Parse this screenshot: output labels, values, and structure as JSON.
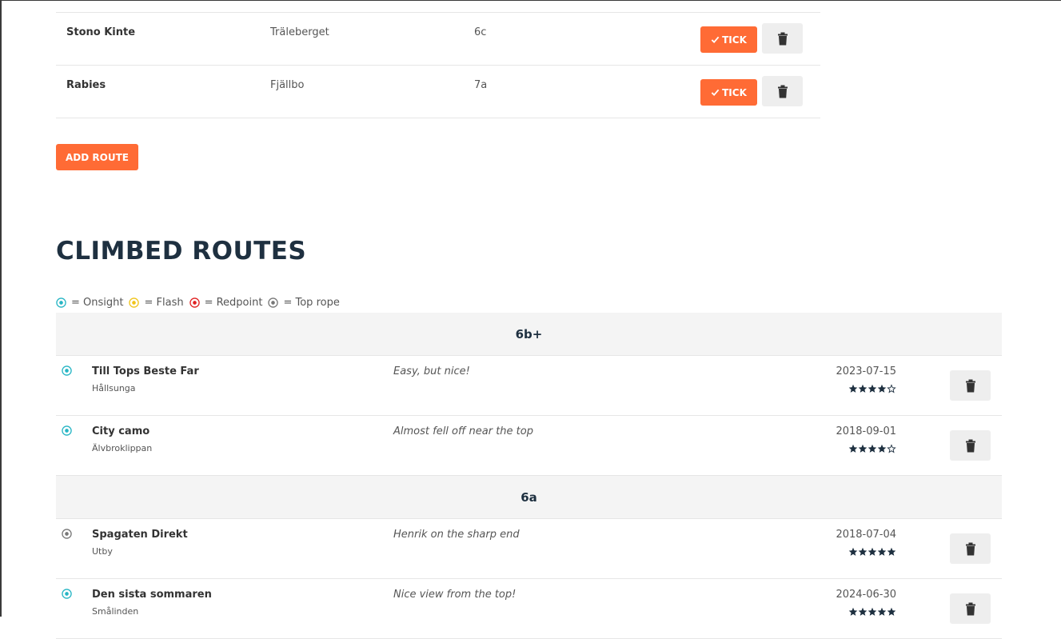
{
  "todo_routes": [
    {
      "name": "Stono Kinte",
      "crag": "Träleberget",
      "grade": "6c"
    },
    {
      "name": "Rabies",
      "crag": "Fjällbo",
      "grade": "7a"
    }
  ],
  "tick_label": "TICK",
  "add_route_label": "ADD ROUTE",
  "climbed_title": "CLIMBED ROUTES",
  "legend": [
    {
      "label": "= Onsight",
      "color": "#26b5c4"
    },
    {
      "label": "= Flash",
      "color": "#f0c419"
    },
    {
      "label": "= Redpoint",
      "color": "#e02020"
    },
    {
      "label": "= Top rope",
      "color": "#777777"
    }
  ],
  "grade_groups": [
    {
      "grade": "6b+",
      "routes": [
        {
          "name": "Till Tops Beste Far",
          "crag": "Hållsunga",
          "comment": "Easy, but nice!",
          "date": "2023-07-15",
          "rating": 4,
          "style": "onsight"
        },
        {
          "name": "City camo",
          "crag": "Älvbroklippan",
          "comment": "Almost fell off near the top",
          "date": "2018-09-01",
          "rating": 4,
          "style": "onsight"
        }
      ]
    },
    {
      "grade": "6a",
      "routes": [
        {
          "name": "Spagaten Direkt",
          "crag": "Utby",
          "comment": "Henrik on the sharp end",
          "date": "2018-07-04",
          "rating": 5,
          "style": "toprope"
        },
        {
          "name": "Den sista sommaren",
          "crag": "Smålinden",
          "comment": "Nice view from the top!",
          "date": "2024-06-30",
          "rating": 5,
          "style": "onsight"
        }
      ]
    }
  ],
  "colors": {
    "accent": "#ff6b35",
    "heading": "#1e3040",
    "onsight": "#26b5c4",
    "flash": "#f0c419",
    "redpoint": "#e02020",
    "toprope": "#777777"
  }
}
